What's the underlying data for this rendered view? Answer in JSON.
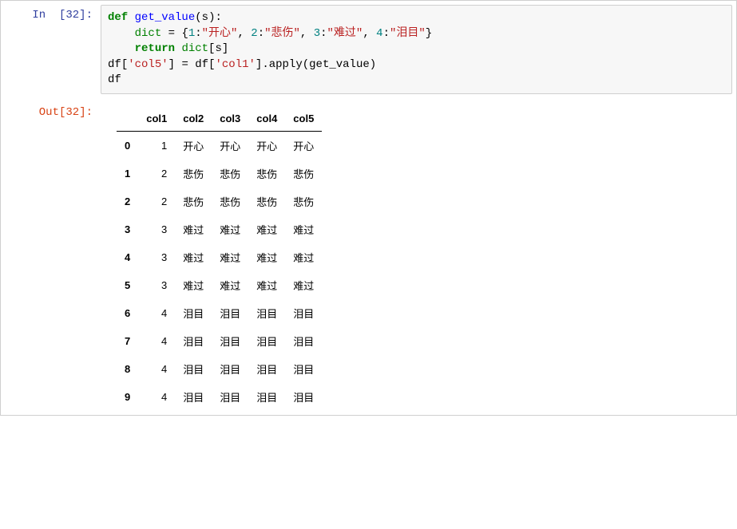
{
  "prompts": {
    "in_label": "In  [32]:",
    "out_label": "Out[32]:"
  },
  "code": {
    "t_def": "def",
    "t_func": "get_value",
    "t_lp": "(",
    "t_arg": "s",
    "t_rp": ")",
    "t_colon": ":",
    "t_indent1": "    ",
    "t_dict": "dict",
    "t_eq": " = ",
    "t_lb": "{",
    "t_n1": "1",
    "t_kc": ":",
    "t_s1": "\"开心\"",
    "t_com": ", ",
    "t_n2": "2",
    "t_s2": "\"悲伤\"",
    "t_n3": "3",
    "t_s3": "\"难过\"",
    "t_n4": "4",
    "t_s4": "\"泪目\"",
    "t_rb": "}",
    "t_return": "return",
    "t_sp": " ",
    "t_sub_l": "[",
    "t_sub_r": "]",
    "t_df": "df",
    "t_col5": "'col5'",
    "t_col1": "'col1'",
    "t_dot": ".",
    "t_apply": "apply",
    "t_gv": "get_value"
  },
  "table": {
    "columns": [
      "col1",
      "col2",
      "col3",
      "col4",
      "col5"
    ],
    "index": [
      "0",
      "1",
      "2",
      "3",
      "4",
      "5",
      "6",
      "7",
      "8",
      "9"
    ],
    "rows": [
      [
        "1",
        "开心",
        "开心",
        "开心",
        "开心"
      ],
      [
        "2",
        "悲伤",
        "悲伤",
        "悲伤",
        "悲伤"
      ],
      [
        "2",
        "悲伤",
        "悲伤",
        "悲伤",
        "悲伤"
      ],
      [
        "3",
        "难过",
        "难过",
        "难过",
        "难过"
      ],
      [
        "3",
        "难过",
        "难过",
        "难过",
        "难过"
      ],
      [
        "3",
        "难过",
        "难过",
        "难过",
        "难过"
      ],
      [
        "4",
        "泪目",
        "泪目",
        "泪目",
        "泪目"
      ],
      [
        "4",
        "泪目",
        "泪目",
        "泪目",
        "泪目"
      ],
      [
        "4",
        "泪目",
        "泪目",
        "泪目",
        "泪目"
      ],
      [
        "4",
        "泪目",
        "泪目",
        "泪目",
        "泪目"
      ]
    ]
  }
}
